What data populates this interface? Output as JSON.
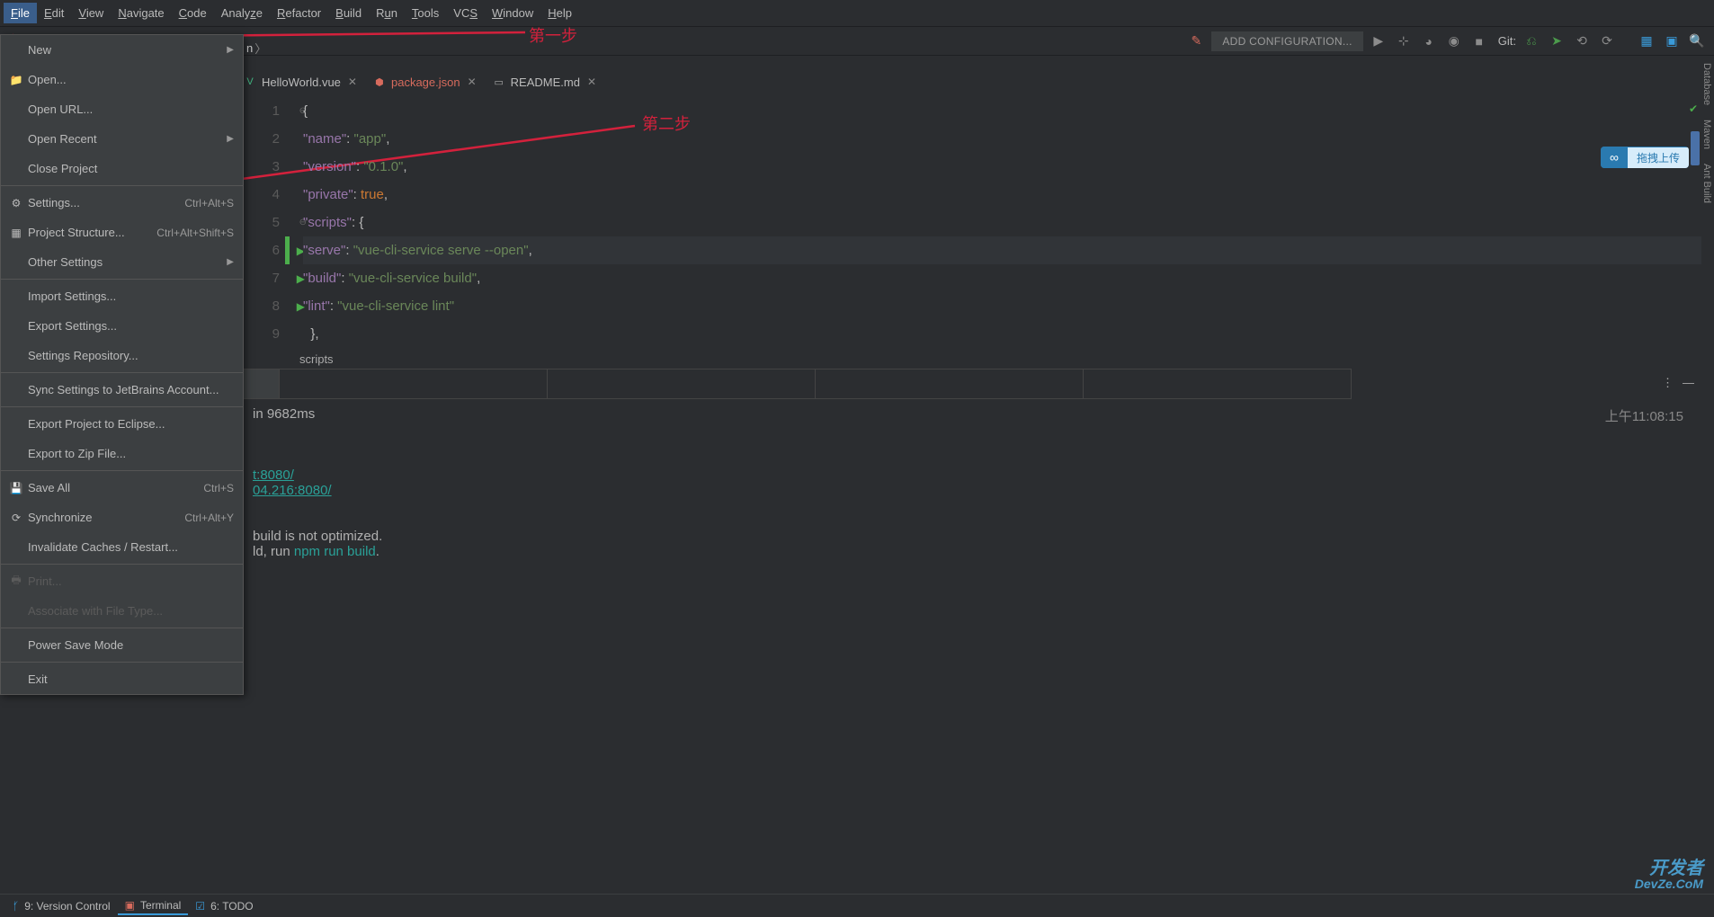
{
  "menubar": [
    "File",
    "Edit",
    "View",
    "Navigate",
    "Code",
    "Analyze",
    "Refactor",
    "Build",
    "Run",
    "Tools",
    "VCS",
    "Window",
    "Help"
  ],
  "annotations": {
    "step1": "第一步",
    "step2": "第二步"
  },
  "toolbar": {
    "add_config": "ADD CONFIGURATION...",
    "git_label": "Git:"
  },
  "dropdown": [
    {
      "label": "New",
      "arrow": true
    },
    {
      "label": "Open...",
      "icon": "folder"
    },
    {
      "label": "Open URL..."
    },
    {
      "label": "Open Recent",
      "arrow": true
    },
    {
      "label": "Close Project"
    },
    {
      "sep": true
    },
    {
      "label": "Settings...",
      "shortcut": "Ctrl+Alt+S",
      "icon": "gear"
    },
    {
      "label": "Project Structure...",
      "shortcut": "Ctrl+Alt+Shift+S",
      "icon": "grid"
    },
    {
      "label": "Other Settings",
      "arrow": true
    },
    {
      "sep": true
    },
    {
      "label": "Import Settings..."
    },
    {
      "label": "Export Settings..."
    },
    {
      "label": "Settings Repository..."
    },
    {
      "sep": true
    },
    {
      "label": "Sync Settings to JetBrains Account..."
    },
    {
      "sep": true
    },
    {
      "label": "Export Project to Eclipse..."
    },
    {
      "label": "Export to Zip File..."
    },
    {
      "sep": true
    },
    {
      "label": "Save All",
      "shortcut": "Ctrl+S",
      "icon": "save"
    },
    {
      "label": "Synchronize",
      "shortcut": "Ctrl+Alt+Y",
      "icon": "sync"
    },
    {
      "label": "Invalidate Caches / Restart..."
    },
    {
      "sep": true
    },
    {
      "label": "Print...",
      "disabled": true,
      "icon": "print"
    },
    {
      "label": "Associate with File Type...",
      "disabled": true
    },
    {
      "sep": true
    },
    {
      "label": "Power Save Mode"
    },
    {
      "sep": true
    },
    {
      "label": "Exit"
    }
  ],
  "breadcrumb_tail": "n",
  "tabs": [
    {
      "name": "HelloWorld.vue",
      "icon": "vue"
    },
    {
      "name": "package.json",
      "icon": "json",
      "active": true
    },
    {
      "name": "README.md",
      "icon": "md"
    }
  ],
  "editor": {
    "lines": [
      {
        "n": 1,
        "raw": "{"
      },
      {
        "n": 2,
        "raw": "  \"name\": \"app\","
      },
      {
        "n": 3,
        "raw": "  \"version\": \"0.1.0\","
      },
      {
        "n": 4,
        "raw": "  \"private\": true,"
      },
      {
        "n": 5,
        "raw": "  \"scripts\": {"
      },
      {
        "n": 6,
        "raw": "    \"serve\": \"vue-cli-service serve --open\",",
        "play": true,
        "hl": true
      },
      {
        "n": 7,
        "raw": "    \"build\": \"vue-cli-service build\",",
        "play": true
      },
      {
        "n": 8,
        "raw": "    \"lint\": \"vue-cli-service lint\"",
        "play": true
      },
      {
        "n": 9,
        "raw": "  },"
      }
    ]
  },
  "breadcrumb2": "scripts",
  "terminal": {
    "line1": "in 9682ms",
    "time": "上午11:08:15",
    "url1": "t:8080/",
    "url2": "04.216:8080/",
    "line4": "build is not optimized.",
    "line5_pre": "ld, run ",
    "line5_cmd": "npm run build",
    "line5_post": "."
  },
  "statusbar": {
    "vc": "9: Version Control",
    "term": "Terminal",
    "todo": "6: TODO"
  },
  "side": {
    "db": "Database",
    "maven": "Maven",
    "ant": "Ant Build"
  },
  "upload": "拖拽上传",
  "watermark": {
    "top": "开发者",
    "bot": "DevZe.CoM"
  }
}
